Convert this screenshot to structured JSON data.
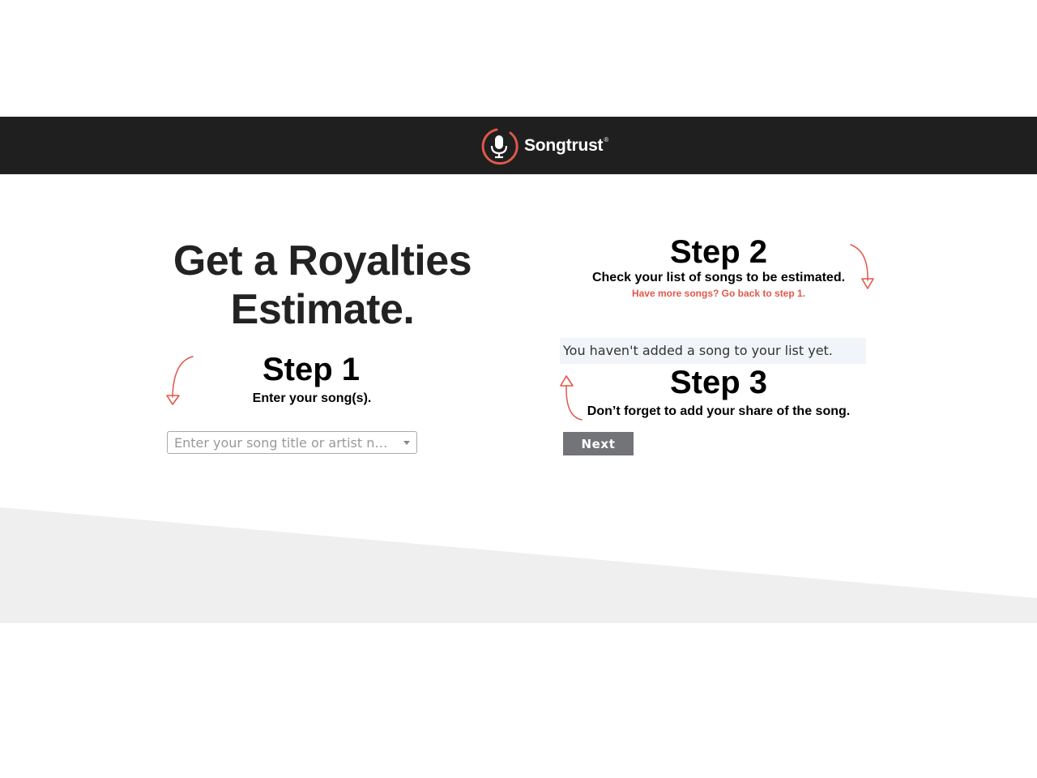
{
  "header": {
    "brand_name": "Songtrust",
    "brand_mark": "®",
    "logo_icon": "microphone-icon",
    "background_color": "#1f1f1f",
    "accent_color": "#e0584a"
  },
  "hero": {
    "title": "Get a Royalties Estimate."
  },
  "step1": {
    "title": "Step 1",
    "subtitle": "Enter your song(s).",
    "search_placeholder": "Enter your song title or artist n…"
  },
  "step2": {
    "title": "Step 2",
    "subtitle": "Check your list of songs to be estimated.",
    "back_link": "Have more songs? Go back to step 1.",
    "empty_message": "You haven't added a song to your list yet."
  },
  "step3": {
    "title": "Step 3",
    "subtitle": "Don’t forget to add your share of the song.",
    "next_label": "Next"
  }
}
